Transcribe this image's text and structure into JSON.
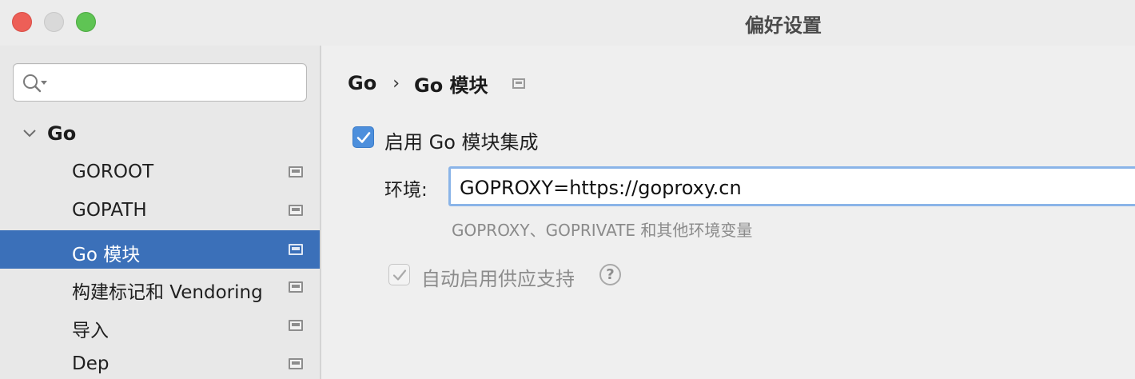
{
  "window": {
    "title": "偏好设置"
  },
  "search": {
    "value": "",
    "placeholder": ""
  },
  "tree": {
    "root_label": "Go",
    "items": [
      {
        "label": "GOROOT"
      },
      {
        "label": "GOPATH"
      },
      {
        "label": "Go 模块"
      },
      {
        "label": "构建标记和 Vendoring"
      },
      {
        "label": "导入"
      },
      {
        "label": "Dep"
      }
    ],
    "selected_index": 2
  },
  "breadcrumb": {
    "parent": "Go",
    "current": "Go 模块",
    "separator": "›"
  },
  "settings": {
    "enable_label": "启用 Go 模块集成",
    "enable_checked": true,
    "env_label": "环境:",
    "env_value": "GOPROXY=https://goproxy.cn",
    "env_hint": "GOPROXY、GOPRIVATE 和其他环境变量",
    "auto_vendor_label": "自动启用供应支持",
    "auto_vendor_checked": true,
    "auto_vendor_enabled": false,
    "help_glyph": "?"
  },
  "colors": {
    "selection": "#3b70b9",
    "checkbox_accent": "#4d8fdc",
    "focus_ring": "#8ab4e8"
  }
}
